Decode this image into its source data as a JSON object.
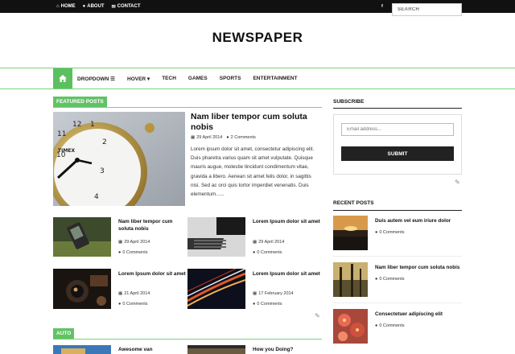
{
  "topbar": {
    "links": [
      {
        "label": "HOME",
        "icon": "home-icon",
        "glyph": "⌂"
      },
      {
        "label": "ABOUT",
        "icon": "user-icon",
        "glyph": "●"
      },
      {
        "label": "CONTACT",
        "icon": "envelope-icon",
        "glyph": "✉"
      }
    ],
    "social": [
      {
        "icon": "facebook-icon",
        "glyph": "f"
      },
      {
        "icon": "twitter-icon",
        "glyph": "t"
      },
      {
        "icon": "google-plus-icon",
        "glyph": "g+"
      },
      {
        "icon": "pinterest-icon",
        "glyph": "P"
      },
      {
        "icon": "instagram-icon",
        "glyph": "◘"
      },
      {
        "icon": "tumblr-icon",
        "glyph": "t"
      },
      {
        "icon": "linkedin-icon",
        "glyph": "in"
      }
    ]
  },
  "logo": "NEWSPAPER",
  "nav": {
    "home_icon": "home-icon",
    "items": [
      {
        "label": "DROPDOWN ☰"
      },
      {
        "label": "HOVER ▾"
      },
      {
        "label": "TECH"
      },
      {
        "label": "GAMES"
      },
      {
        "label": "SPORTS"
      },
      {
        "label": "ENTERTAINMENT"
      }
    ],
    "search_placeholder": "SEARCH"
  },
  "featured": {
    "label": "FEATURED POSTS",
    "main": {
      "title": "Nam liber tempor cum soluta nobis",
      "date": "29 April 2014",
      "comments": "2 Comments",
      "excerpt": "Lorem ipsum dolor sit amet, consectetur adipiscing elit. Duis pharetra varius quam sit amet vulputate. Quisque mauris augue, molestie tincidunt condimentum vitae, gravida a libero. Aenean sit amet felis dolor, in sagittis nisi. Sed ac orci quis tortor imperdiet venenatis. Duis elementum......"
    },
    "grid": [
      {
        "title": "Nam liber tempor cum soluta nobis",
        "date": "29 April 2014",
        "comments": "0 Comments"
      },
      {
        "title": "Lorem Ipsum dolor sit amet",
        "date": "29 April 2014",
        "comments": "0 Comments"
      },
      {
        "title": "Lorem Ipsum dolor sit amet",
        "date": "21 April 2014",
        "comments": "0 Comments"
      },
      {
        "title": "Lorem Ipsum dolor sit amet",
        "date": "17 February 2014",
        "comments": "0 Comments"
      }
    ]
  },
  "auto": {
    "label": "AUTO",
    "items": [
      {
        "title": "Awesome van"
      },
      {
        "title": "How you Doing?"
      }
    ]
  },
  "sidebar": {
    "subscribe_title": "SUBSCRIBE",
    "email_placeholder": "Email address...",
    "submit_label": "SUBMIT",
    "recent_title": "RECENT POSTS",
    "recent": [
      {
        "title": "Duis autem vel eum iriure dolor",
        "comments": "0 Comments"
      },
      {
        "title": "Nam liber tempor cum soluta nobis",
        "comments": "0 Comments"
      },
      {
        "title": "Consectetuer adipiscing elit",
        "comments": "0 Comments"
      }
    ]
  },
  "colors": {
    "accent": "#5cbf60",
    "topbar": "#111111"
  }
}
